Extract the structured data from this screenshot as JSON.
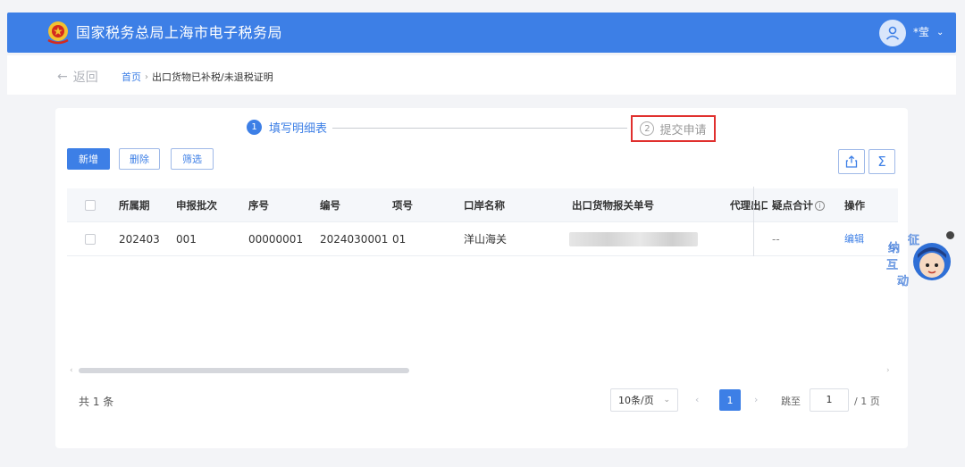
{
  "header": {
    "site_title": "国家税务总局上海市电子税务局",
    "user_name": "*莹",
    "caret": "⌄"
  },
  "subbar": {
    "back_arrow": "←",
    "back_label": "返回",
    "home": "首页",
    "separator": "›",
    "current": "出口货物已补税/未退税证明"
  },
  "steps": [
    {
      "num": "1",
      "label": "填写明细表",
      "active": true
    },
    {
      "num": "2",
      "label": "提交申请",
      "active": false
    }
  ],
  "toolbar": {
    "add": "新增",
    "delete": "删除",
    "filter": "筛选",
    "export_icon": "share-export-icon",
    "sum_icon": "sigma-icon",
    "sum_glyph": "Σ"
  },
  "table": {
    "columns": [
      "所属期",
      "申报批次",
      "序号",
      "编号",
      "项号",
      "口岸名称",
      "出口货物报关单号",
      "代理出口",
      "疑点合计",
      "操作"
    ],
    "rows": [
      [
        "202403",
        "001",
        "00000001",
        "2024030001",
        "01",
        "洋山海关",
        "",
        "",
        "--",
        "编辑"
      ]
    ],
    "info_glyph": "i"
  },
  "scroll": {
    "left": "‹",
    "right": "›",
    "position": 0.4
  },
  "pagination": {
    "total": "共 1 条",
    "page_size": "10条/页",
    "size_caret": "⌄",
    "prev": "‹",
    "current": "1",
    "next": "›",
    "jump_label": "跳至",
    "jump_value": "1",
    "total_pages": "/ 1 页"
  },
  "helper": {
    "text": [
      "征",
      "纳",
      "互",
      "动"
    ]
  },
  "colors": {
    "primary": "#3d7fe6",
    "highlight": "#e0302e"
  }
}
